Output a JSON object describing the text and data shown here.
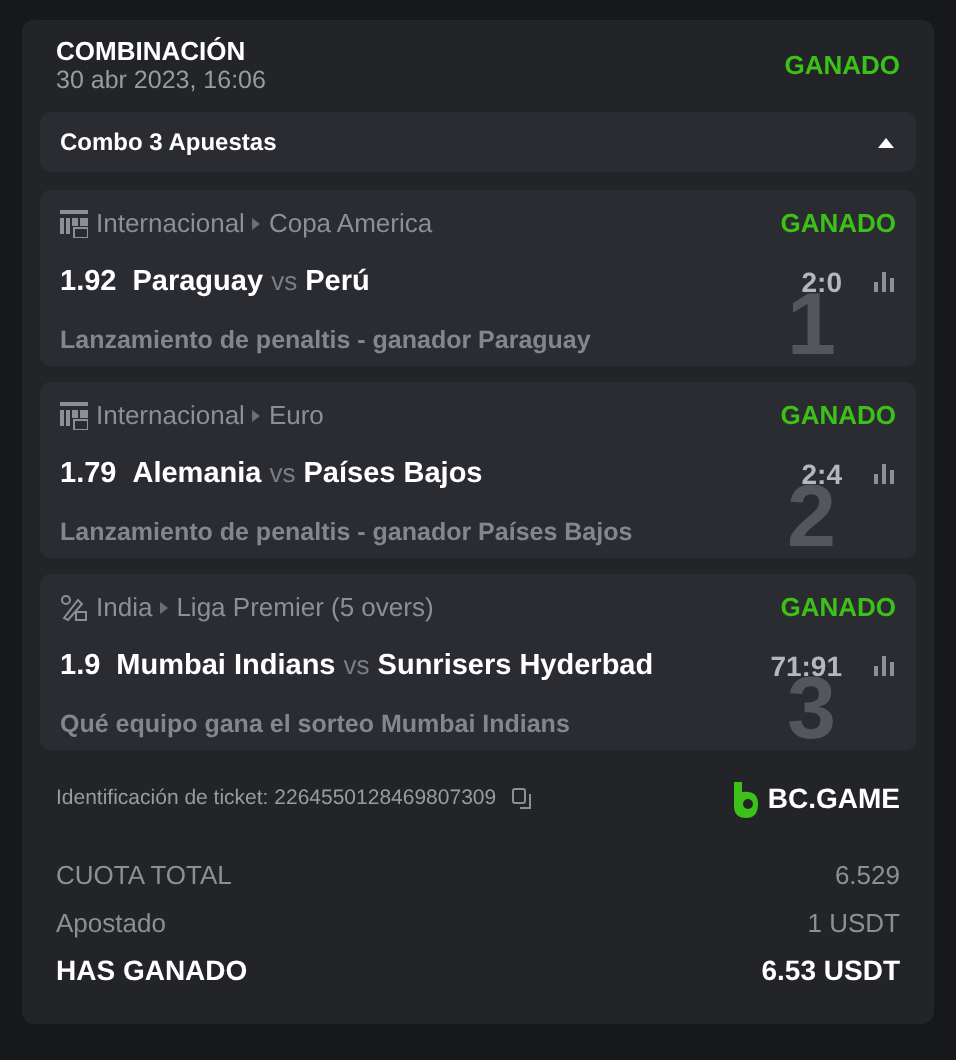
{
  "bet_slip": {
    "title": "COMBINACIÓN",
    "date": "30 abr 2023, 16:06",
    "status": "GANADO"
  },
  "combo": {
    "label": "Combo 3 Apuestas",
    "expanded": true
  },
  "bets": [
    {
      "kind": "fifa",
      "country": "Internacional",
      "league": "Copa America",
      "status": "GANADO",
      "odds": "1.92",
      "home": "Paraguay",
      "vs": "vs",
      "away": "Perú",
      "score": "2:0",
      "market": "Lanzamiento de penaltis - ganador Paraguay",
      "number": "1"
    },
    {
      "kind": "fifa",
      "country": "Internacional",
      "league": "Euro",
      "status": "GANADO",
      "odds": "1.79",
      "home": "Alemania",
      "vs": "vs",
      "away": "Países Bajos",
      "score": "2:4",
      "market": "Lanzamiento de penaltis - ganador Países Bajos",
      "number": "2"
    },
    {
      "kind": "cricket",
      "country": "India",
      "league": "Liga Premier (5 overs)",
      "status": "GANADO",
      "odds": "1.9",
      "home": "Mumbai Indians",
      "vs": "vs",
      "away": "Sunrisers Hyderbad",
      "score": "71:91",
      "market": "Qué equipo gana el sorteo Mumbai Indians",
      "number": "3"
    }
  ],
  "ticket": {
    "label": "Identificación de ticket: 2264550128469807309"
  },
  "brand": "BC.GAME",
  "totals": [
    {
      "kind": "odds",
      "label": "CUOTA TOTAL",
      "value": "6.529"
    },
    {
      "kind": "stake",
      "label": "Apostado",
      "value": "1 USDT"
    },
    {
      "kind": "win",
      "label": "HAS GANADO",
      "value": "6.53 USDT"
    }
  ]
}
